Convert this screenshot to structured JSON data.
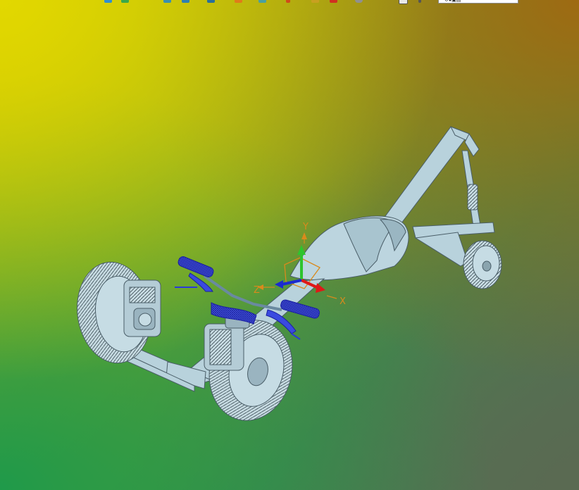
{
  "toolbar": {
    "icons": [
      {
        "name": "save-icon",
        "color": "#2f8fd0"
      },
      {
        "name": "undo-icon",
        "color": "#3aa84a"
      },
      {
        "name": "view-front-icon",
        "color": "#3a8fb0"
      },
      {
        "name": "view-iso-icon",
        "color": "#2f7fb0"
      },
      {
        "name": "view-top-icon",
        "color": "#2a6f9a"
      },
      {
        "name": "shade-icon",
        "color": "#e07b1a"
      },
      {
        "name": "render-icon",
        "color": "#4aa0a0"
      },
      {
        "name": "measure-icon",
        "color": "#d04a1a"
      },
      {
        "name": "section-icon",
        "color": "#c8a020"
      },
      {
        "name": "delete-icon",
        "color": "#d03020"
      },
      {
        "name": "display-icon",
        "color": "#909090"
      },
      {
        "name": "document-icon",
        "color": "#e8e8e8"
      },
      {
        "name": "pointer-icon",
        "color": "#555555"
      }
    ],
    "selection_value": "↺●▣▤"
  },
  "triad": {
    "x_label": "X",
    "y_label": "Y",
    "z_label": "Z",
    "x_color": "#e01818",
    "y_color": "#2ec42e",
    "z_color": "#1a2ad0"
  },
  "model": {
    "part_color": "#b8d2dc",
    "edge_color": "#4a5e68",
    "highlight_color": "#2a3ad8"
  }
}
